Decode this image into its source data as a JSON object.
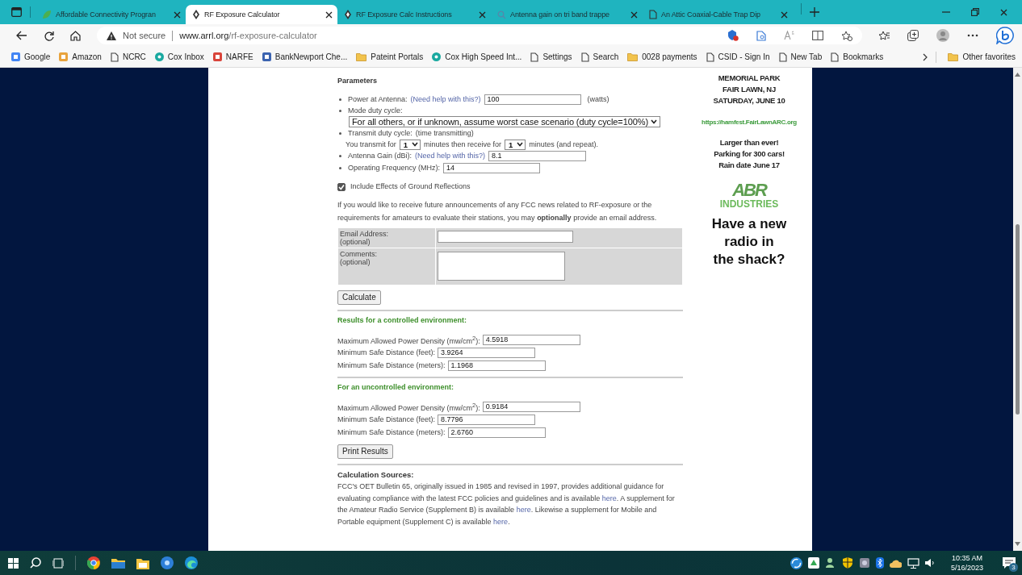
{
  "tabs": [
    {
      "label": "Affordable Connectivity Progran",
      "kind": "leaf",
      "selected": false
    },
    {
      "label": "RF Exposure Calculator",
      "kind": "diamond",
      "selected": true
    },
    {
      "label": "RF Exposure Calc Instructions",
      "kind": "diamond",
      "selected": false
    },
    {
      "label": "Antenna gain on tri band trappe",
      "kind": "search",
      "selected": false
    },
    {
      "label": "An Attic Coaxial-Cable Trap Dip",
      "kind": "page",
      "selected": false
    }
  ],
  "address": {
    "security": "Not secure",
    "domain": "www.arrl.org",
    "path": "/rf-exposure-calculator"
  },
  "bookmarks": [
    {
      "label": "Google",
      "kind": "logo",
      "color": "#4285f4"
    },
    {
      "label": "Amazon",
      "kind": "logo",
      "color": "#e8a33d"
    },
    {
      "label": "NCRC",
      "kind": "page"
    },
    {
      "label": "Cox Inbox",
      "kind": "dot",
      "color": "#1aa9a0"
    },
    {
      "label": "NARFE",
      "kind": "logo",
      "color": "#d9443a"
    },
    {
      "label": "BankNewport Che...",
      "kind": "logo",
      "color": "#3b63b0"
    },
    {
      "label": "Pateint Portals",
      "kind": "folder"
    },
    {
      "label": "Cox High Speed Int...",
      "kind": "dot",
      "color": "#1aa9a0"
    },
    {
      "label": "Settings",
      "kind": "page"
    },
    {
      "label": "Search",
      "kind": "page"
    },
    {
      "label": "0028 payments",
      "kind": "folder"
    },
    {
      "label": "CSID - Sign In",
      "kind": "page"
    },
    {
      "label": "New Tab",
      "kind": "page"
    },
    {
      "label": "Bookmarks",
      "kind": "page"
    }
  ],
  "other_favorites": "Other favorites",
  "form": {
    "heading": "Parameters",
    "power": {
      "label": "Power at Antenna:",
      "help": "(Need help with this?)",
      "value": "100",
      "unit": "(watts)"
    },
    "mode": {
      "label": "Mode duty cycle:",
      "value": "For all others, or if unknown, assume worst case scenario (duty cycle=100%)"
    },
    "transmit": {
      "label": "Transmit duty cycle:",
      "note": "(time transmitting)",
      "prefix": "You transmit for",
      "tx": "1",
      "middle": "minutes then receive for",
      "rx": "1",
      "suffix": "minutes (and repeat)."
    },
    "gain": {
      "label": "Antenna Gain (dBi):",
      "help": "(Need help with this?)",
      "value": "8.1"
    },
    "frequency": {
      "label": "Operating Frequency (MHz):",
      "value": "14"
    },
    "ground": {
      "label": "Include Effects of Ground Reflections",
      "checked": true
    },
    "notice": "If you would like to receive future announcements of any FCC news related to RF-exposure or the requirements for amateurs to evaluate their stations, you may **optionally** provide an email address.",
    "email": {
      "label": "Email Address:",
      "note": "(optional)"
    },
    "comments": {
      "label": "Comments:",
      "note": "(optional)"
    },
    "calculate": "Calculate",
    "results": [
      {
        "heading": "Results for a controlled environment:",
        "rows": [
          {
            "label": "Maximum Allowed Power Density (mw/cm$^{2}$):",
            "value": "4.5918"
          },
          {
            "label": "Minimum Safe Distance (feet):",
            "value": "3.9264"
          },
          {
            "label": "Minimum Safe Distance (meters):",
            "value": "1.1968"
          }
        ]
      },
      {
        "heading": "For an uncontrolled environment:",
        "rows": [
          {
            "label": "Maximum Allowed Power Density (mw/cm$^{2}$):",
            "value": "0.9184"
          },
          {
            "label": "Minimum Safe Distance (feet):",
            "value": "8.7796"
          },
          {
            "label": "Minimum Safe Distance (meters):",
            "value": "2.6760"
          }
        ]
      }
    ],
    "print": "Print Results",
    "sources": {
      "heading": "Calculation Sources:",
      "segments": [
        {
          "kind": "text",
          "text": "FCC's OET Bulletin 65, originally issued in 1985 and revised in 1997, provides additional guidance for evaluating compliance with the latest FCC policies and guidelines and is available "
        },
        {
          "kind": "link",
          "text": "here"
        },
        {
          "kind": "text",
          "text": ". A supplement for the Amateur Radio Service (Supplement B) is available "
        },
        {
          "kind": "link",
          "text": "here"
        },
        {
          "kind": "text",
          "text": ". Likewise a supplement for Mobile and Portable equipment (Supplement C) is available "
        },
        {
          "kind": "link",
          "text": "here"
        },
        {
          "kind": "text",
          "text": "."
        }
      ]
    }
  },
  "ad": {
    "event_lines": [
      "MEMORIAL PARK",
      "FAIR LAWN, NJ",
      "SATURDAY, JUNE 10"
    ],
    "url": "https://hamfest.FairLawnARC.org",
    "promo_lines": [
      "Larger than ever!",
      "Parking for 300 cars!",
      "Rain date June 17"
    ],
    "logo_mark": "ABR",
    "logo_name": "INDUSTRIES",
    "headline": "Have a new\nradio in\nthe shack?"
  },
  "taskbar": {
    "time": "10:35 AM",
    "date": "5/16/2023",
    "notifications": "3"
  }
}
